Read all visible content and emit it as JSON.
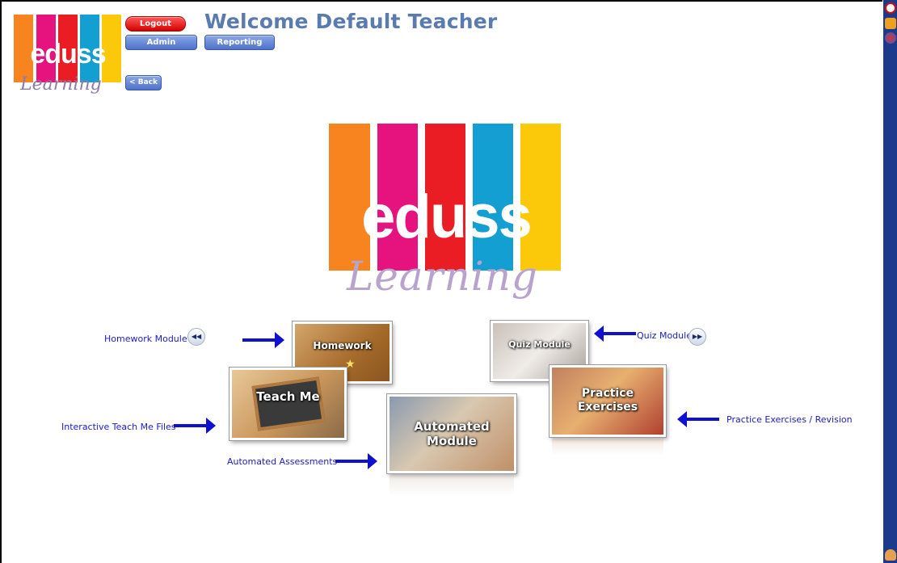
{
  "header": {
    "welcome": "Welcome Default Teacher",
    "logout_label": "Logout",
    "admin_label": "Admin",
    "reporting_label": "Reporting",
    "back_label": "< Back"
  },
  "logo": {
    "text_main": "eduss",
    "text_script": "Learning",
    "bar_colors": [
      "#f7841f",
      "#e6127d",
      "#ea1d24",
      "#139fd1",
      "#fbc80a"
    ]
  },
  "modules": {
    "homework": {
      "label": "Homework Module",
      "tile": "Homework"
    },
    "quiz": {
      "label": "Quiz Module",
      "tile": "Quiz Module"
    },
    "teach": {
      "label": "Interactive Teach Me Files",
      "tile": "Teach Me"
    },
    "practice": {
      "label": "Practice Exercises / Revision",
      "tile_line1": "Practice",
      "tile_line2": "Exercises"
    },
    "automated": {
      "label": "Automated Assessments",
      "tile_line1": "Automated",
      "tile_line2": "Module"
    }
  },
  "nav": {
    "prev_icon": "rewind-icon",
    "next_icon": "fast-forward-icon",
    "prev_symbol": "◀◀",
    "next_symbol": "▶▶"
  },
  "colors": {
    "label_blue": "#1a1acf",
    "arrow_blue": "#1010d0",
    "welcome": "#5a7bb0",
    "sidebar": "#1b3a8c"
  }
}
